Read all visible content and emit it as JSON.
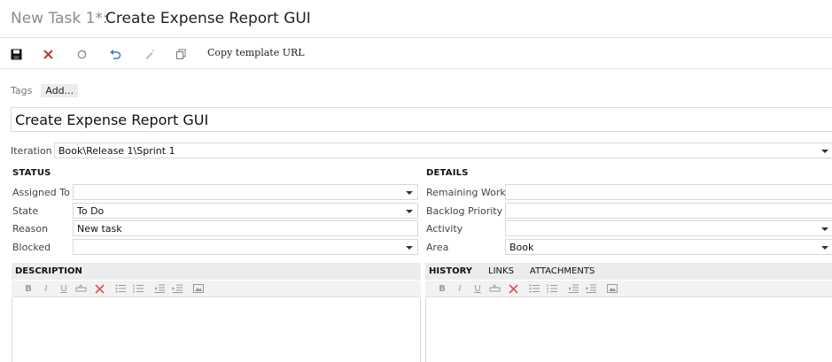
{
  "header": {
    "prefix": "New Task 1*:",
    "title": "Create Expense Report GUI"
  },
  "toolbar": {
    "save_icon": "save-icon",
    "discard_icon": "close-icon",
    "refresh_icon": "refresh-icon",
    "undo_icon": "undo-icon",
    "edit_icon": "edit-icon",
    "copy_icon": "copy-icon",
    "copy_template_label": "Copy template URL"
  },
  "tags": {
    "label": "Tags",
    "add_label": "Add..."
  },
  "work_item": {
    "title_value": "Create Expense Report GUI"
  },
  "iteration": {
    "label": "Iteration",
    "value": "Book\\Release 1\\Sprint 1"
  },
  "status": {
    "heading": "STATUS",
    "assigned_to": {
      "label": "Assigned To",
      "value": ""
    },
    "state": {
      "label": "State",
      "value": "To Do"
    },
    "reason": {
      "label": "Reason",
      "value": "New task"
    },
    "blocked": {
      "label": "Blocked",
      "value": ""
    }
  },
  "details": {
    "heading": "DETAILS",
    "remaining_work": {
      "label": "Remaining Work",
      "value": ""
    },
    "backlog_priority": {
      "label": "Backlog Priority",
      "value": ""
    },
    "activity": {
      "label": "Activity",
      "value": ""
    },
    "area": {
      "label": "Area",
      "value": "Book"
    }
  },
  "description": {
    "heading": "DESCRIPTION"
  },
  "history_tabs": {
    "history": "HISTORY",
    "links": "LINKS",
    "attachments": "ATTACHMENTS"
  },
  "rich_text_toolbar": {
    "bold": "B",
    "italic": "I",
    "underline": "U"
  },
  "colors": {
    "discard_red": "#c0392b",
    "undo_blue": "#3a7bd5",
    "panel_bg": "#ececec"
  }
}
